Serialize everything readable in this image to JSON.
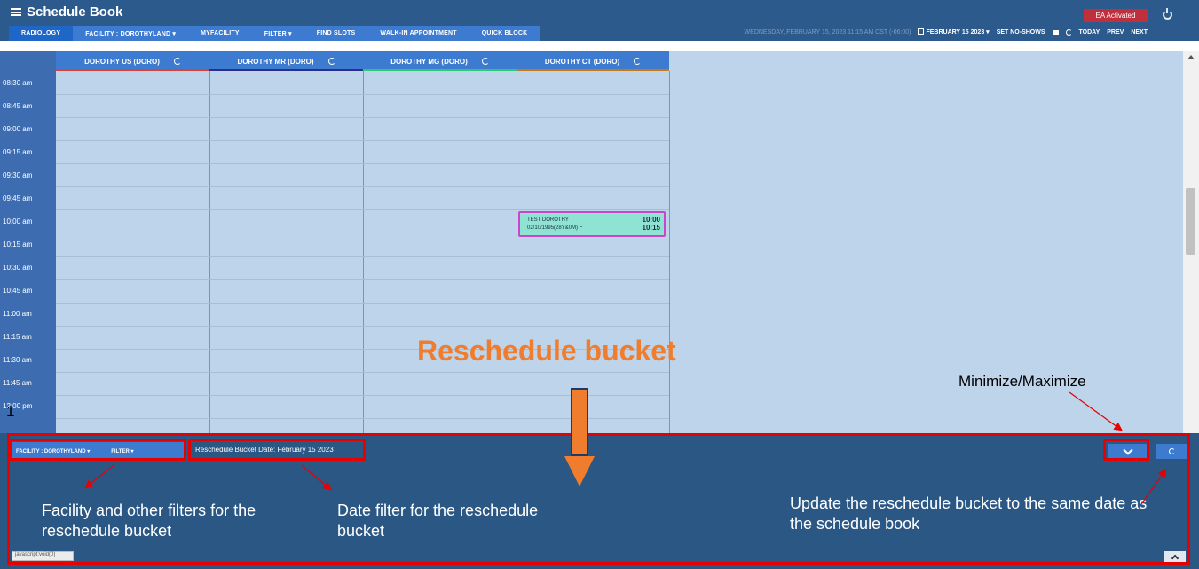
{
  "header": {
    "title": "Schedule Book",
    "nav": [
      "RADIOLOGY",
      "FACILITY : DOROTHYLAND ▾",
      "MYFACILITY",
      "FILTER ▾",
      "FIND SLOTS",
      "WALK-IN APPOINTMENT",
      "QUICK BLOCK"
    ],
    "badge": "EA Activated",
    "datetime": "WEDNESDAY, FEBRUARY 15, 2023 11:15 AM CST (-06:00)",
    "date_picker": "FEBRUARY 15 2023 ▾",
    "set_no_shows": "SET NO-SHOWS",
    "today": "TODAY",
    "prev": "PREV",
    "next": "NEXT"
  },
  "columns": [
    {
      "label": "DOROTHY US (DORO)",
      "color": "#d9413a"
    },
    {
      "label": "DOROTHY MR (DORO)",
      "color": "#2b2f8c"
    },
    {
      "label": "DOROTHY MG (DORO)",
      "color": "#2fc77a"
    },
    {
      "label": "DOROTHY CT (DORO)",
      "color": "#c2781b"
    }
  ],
  "times": [
    "08:30 am",
    "08:45 am",
    "09:00 am",
    "09:15 am",
    "09:30 am",
    "09:45 am",
    "10:00 am",
    "10:15 am",
    "10:30 am",
    "10:45 am",
    "11:00 am",
    "11:15 am",
    "11:30 am",
    "11:45 am",
    "12:00 pm"
  ],
  "appointment": {
    "name": "TEST DOROTHY",
    "details": "02/10/1995(28Y&0M) F",
    "start": "10:00",
    "end": "10:15"
  },
  "bucket": {
    "facility": "FACILITY : DOROTHYLAND ▾",
    "filter": "FILTER ▾",
    "date": "Reschedule Bucket Date: February 15 2023",
    "status_url": "javascript:void(0)"
  },
  "annotations": {
    "title": "Reschedule bucket",
    "minimize": "Minimize/Maximize",
    "facility_filters": "Facility and other filters for the reschedule bucket",
    "date_filter": "Date filter for the reschedule bucket",
    "update": "Update the reschedule bucket to the same date as the schedule book",
    "stray": "1"
  }
}
